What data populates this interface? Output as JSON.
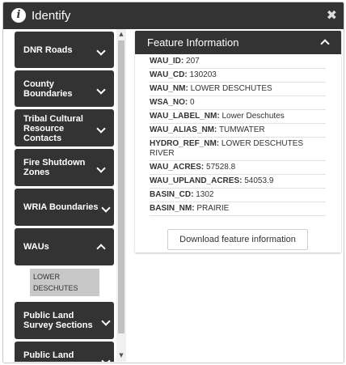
{
  "window": {
    "title": "Identify",
    "close_glyph": "✖",
    "info_glyph": "i"
  },
  "sidebar": {
    "items": [
      {
        "label": "DNR Roads",
        "state": "collapsed"
      },
      {
        "label": "County Boundaries",
        "state": "collapsed"
      },
      {
        "label": "Tribal Cultural Resource Contacts",
        "state": "collapsed"
      },
      {
        "label": "Fire Shutdown Zones",
        "state": "collapsed"
      },
      {
        "label": "WRIA Boundaries",
        "state": "collapsed"
      },
      {
        "label": "WAUs",
        "state": "expanded",
        "children": [
          "LOWER DESCHUTES"
        ]
      },
      {
        "label": "Public Land Survey Sections",
        "state": "collapsed"
      },
      {
        "label": "Public Land",
        "state": "collapsed"
      }
    ]
  },
  "feature": {
    "header": "Feature Information",
    "attributes": [
      {
        "key": "WAU_ID:",
        "value": "207"
      },
      {
        "key": "WAU_CD:",
        "value": "130203"
      },
      {
        "key": "WAU_NM:",
        "value": "LOWER DESCHUTES"
      },
      {
        "key": "WSA_NO:",
        "value": "0"
      },
      {
        "key": "WAU_LABEL_NM:",
        "value": "Lower Deschutes"
      },
      {
        "key": "WAU_ALIAS_NM:",
        "value": "TUMWATER"
      },
      {
        "key": "HYDRO_REF_NM:",
        "value": "LOWER DESCHUTES RIVER"
      },
      {
        "key": "WAU_ACRES:",
        "value": "57528.8"
      },
      {
        "key": "WAU_UPLAND_ACRES:",
        "value": "54053.9"
      },
      {
        "key": "BASIN_CD:",
        "value": "1302"
      },
      {
        "key": "BASIN_NM:",
        "value": "PRAIRIE"
      }
    ],
    "download_label": "Download feature information"
  }
}
